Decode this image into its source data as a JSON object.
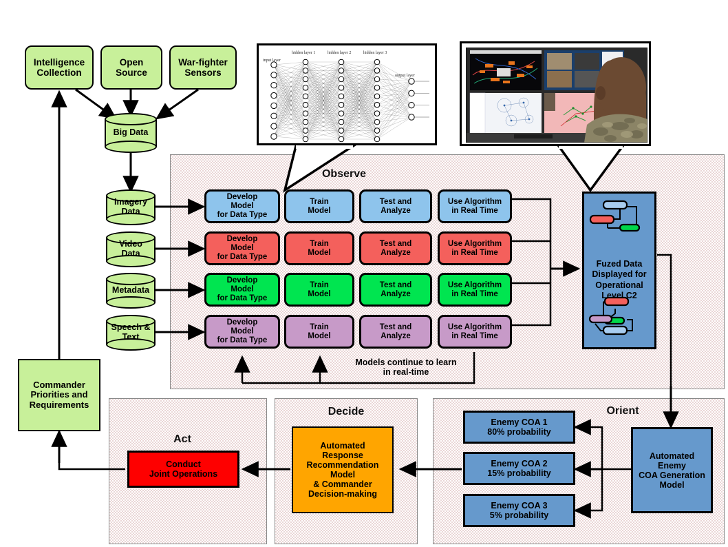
{
  "sources": [
    {
      "id": "intelligence-collection",
      "label": "Intelligence\nCollection"
    },
    {
      "id": "open-source",
      "label": "Open\nSource"
    },
    {
      "id": "war-fighter-sensors",
      "label": "War-fighter\nSensors"
    }
  ],
  "big_data": {
    "label": "Big Data"
  },
  "data_stores": [
    {
      "id": "imagery-data",
      "label": "Imagery\nData"
    },
    {
      "id": "video-data",
      "label": "Video\nData"
    },
    {
      "id": "metadata",
      "label": "Metadata"
    },
    {
      "id": "speech-text",
      "label": "Speech &\nText"
    }
  ],
  "commander": {
    "label": "Commander\nPriorities and\nRequirements"
  },
  "observe": {
    "title": "Observe",
    "stage_labels": [
      "Develop\nModel\nfor Data Type",
      "Train\nModel",
      "Test and\nAnalyze",
      "Use Algorithm\nin Real Time"
    ],
    "rows": [
      {
        "id": "imagery-pipeline",
        "color": "#8ec4ec",
        "color_name": "blue"
      },
      {
        "id": "video-pipeline",
        "color": "#f4605c",
        "color_name": "red"
      },
      {
        "id": "metadata-pipeline",
        "color": "#00e550",
        "color_name": "green"
      },
      {
        "id": "speech-text-pipeline",
        "color": "#c79ac8",
        "color_name": "purple"
      }
    ],
    "feedback_note": "Models continue to learn\nin real-time"
  },
  "fuzed": {
    "label": "Fuzed Data\nDisplayed for\nOperational\nLevel C2"
  },
  "orient": {
    "title": "Orient",
    "generator": {
      "label": "Automated\nEnemy\nCOA Generation\nModel"
    },
    "coas": [
      {
        "id": "enemy-coa-1",
        "label": "Enemy COA 1\n80% probability",
        "name": "Enemy COA 1",
        "probability": "80%"
      },
      {
        "id": "enemy-coa-2",
        "label": "Enemy COA 2\n15% probability",
        "name": "Enemy COA 2",
        "probability": "15%"
      },
      {
        "id": "enemy-coa-3",
        "label": "Enemy COA 3\n5% probability",
        "name": "Enemy COA 3",
        "probability": "5%"
      }
    ]
  },
  "decide": {
    "title": "Decide",
    "model": {
      "label": "Automated\nResponse\nRecommendation\nModel\n& Commander\nDecision-making"
    }
  },
  "act": {
    "title": "Act",
    "operation": {
      "label": "Conduct\nJoint Operations"
    }
  },
  "neural_network_callout": {
    "layer_labels": [
      "input layer",
      "hidden layer 1",
      "hidden layer 2",
      "hidden layer 3",
      "output layer"
    ],
    "layer_sizes": [
      8,
      10,
      10,
      10,
      4
    ]
  },
  "photo_callout": {
    "alt": "Soldier at multi-monitor operational command and control workstation"
  },
  "colors": {
    "source_green": "#c8f09a",
    "pipeline_blue": "#8ec4ec",
    "pipeline_red": "#f4605c",
    "pipeline_green": "#00e550",
    "pipeline_purple": "#c79ac8",
    "display_blue": "#6699cc",
    "decide_orange": "#ffa500",
    "act_red": "#fe0000",
    "panel_pink": "#ead6d6"
  }
}
